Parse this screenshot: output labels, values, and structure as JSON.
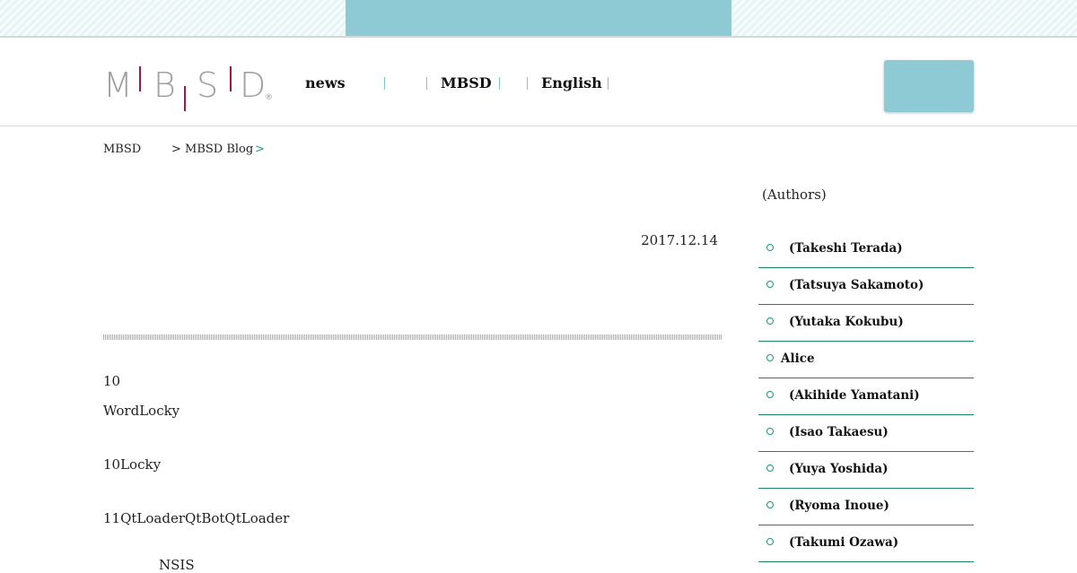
{
  "header": {
    "logo_letters": [
      "M",
      "B",
      "S",
      "D"
    ],
    "logo_mark": "®",
    "nav": [
      {
        "label": "news"
      },
      {
        "label": ""
      },
      {
        "label": "MBSD"
      },
      {
        "label": "English"
      }
    ]
  },
  "breadcrumb": {
    "home": "MBSD",
    "current": "> MBSD Blog",
    "trail_end": ">"
  },
  "post": {
    "date": "2017.12.14",
    "lines": [
      "10",
      "WordLocky",
      "10Locky",
      "11QtLoaderQtBotQtLoader",
      "NSIS"
    ]
  },
  "sidebar": {
    "title": "(Authors)",
    "authors": [
      "(Takeshi Terada)",
      "(Tatsuya Sakamoto)",
      "(Yutaka Kokubu)",
      "Alice",
      "(Akihide Yamatani)",
      "(Isao Takaesu)",
      "(Yuya Yoshida)",
      "(Ryoma Inoue)",
      "(Takumi Ozawa)"
    ]
  },
  "colors": {
    "accent_teal": "#8ecad3",
    "accent_green": "#1a9c70",
    "logo_red": "#a8173e",
    "logo_gray": "#a0a0a0"
  }
}
